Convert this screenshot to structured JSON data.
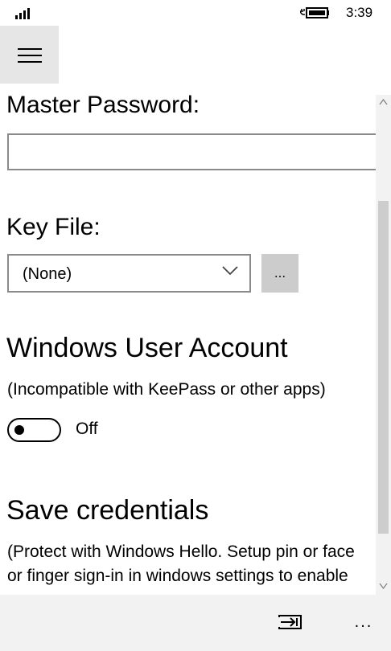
{
  "status_bar": {
    "time": "3:39",
    "signal_icon": "signal-bars-icon",
    "battery_icon": "battery-charging-icon"
  },
  "nav": {
    "menu_icon": "hamburger-menu-icon"
  },
  "form": {
    "master_password": {
      "label": "Master Password:",
      "value": ""
    },
    "key_file": {
      "label": "Key File:",
      "selected": "(None)",
      "browse_label": "..."
    },
    "windows_user_account": {
      "heading": "Windows User Account",
      "note": "(Incompatible with KeePass or other apps)",
      "toggle_state": "Off"
    },
    "save_credentials": {
      "heading": "Save credentials",
      "note_line1": "(Protect with Windows Hello. Setup pin or face",
      "note_line2": "or finger sign-in in windows settings to enable"
    }
  },
  "app_bar": {
    "login_icon": "enter-arrow-icon",
    "more_label": "..."
  },
  "colors": {
    "hamburger_bg": "#e6e6e6",
    "button_bg": "#cccccc",
    "border": "#8a8a8a",
    "app_bar_bg": "#f2f2f2"
  }
}
